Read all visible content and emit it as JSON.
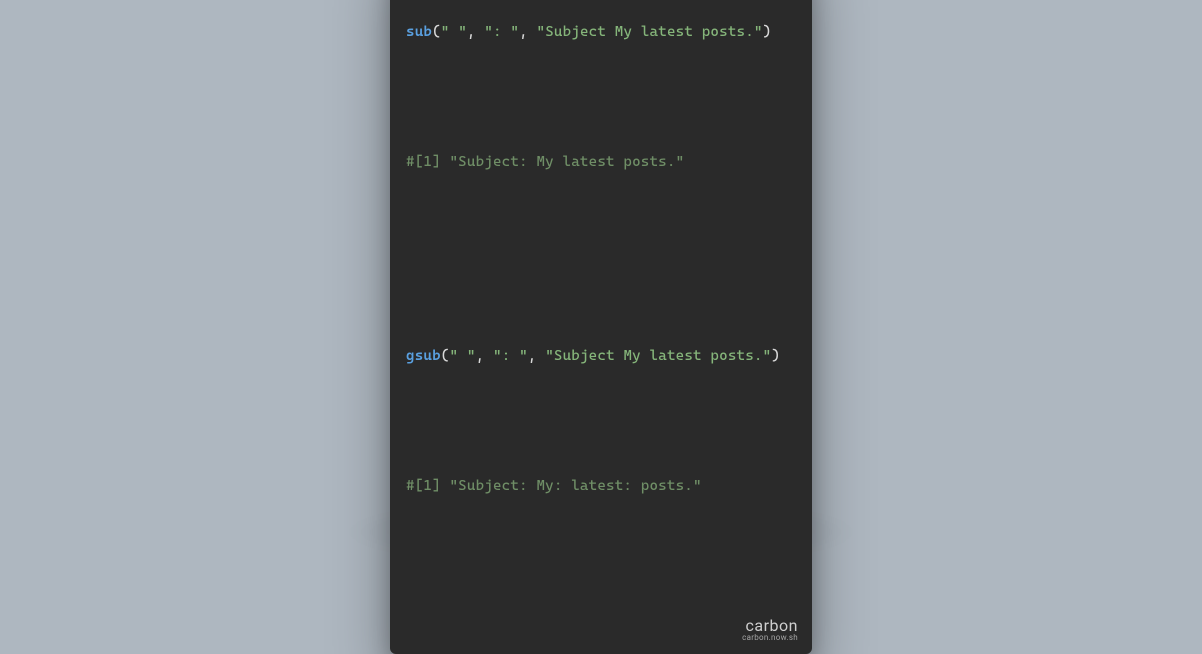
{
  "code": {
    "line1": {
      "func": "sub",
      "open": "(",
      "arg1": "\" \"",
      "sep1": ", ",
      "arg2": "\": \"",
      "sep2": ", ",
      "arg3": "\"Subject My latest posts.\"",
      "close": ")"
    },
    "line2_blank": "",
    "line3_comment": "#[1] \"Subject: My latest posts.\"",
    "line4_blank": "",
    "line5_blank": "",
    "line6": {
      "func": "gsub",
      "open": "(",
      "arg1": "\" \"",
      "sep1": ", ",
      "arg2": "\": \"",
      "sep2": ", ",
      "arg3": "\"Subject My latest posts.\"",
      "close": ")"
    },
    "line7_blank": "",
    "line8_comment": "#[1] \"Subject: My: latest: posts.\"",
    "line9_blank": ""
  },
  "watermark": {
    "brand": "carbon",
    "sub": "carbon.now.sh"
  },
  "colors": {
    "background": "#aeb7c0",
    "window": "#2a2a2a",
    "func": "#5aa0e0",
    "string": "#85b57a",
    "comment": "#6f8e66",
    "punct": "#d8d8d8"
  }
}
